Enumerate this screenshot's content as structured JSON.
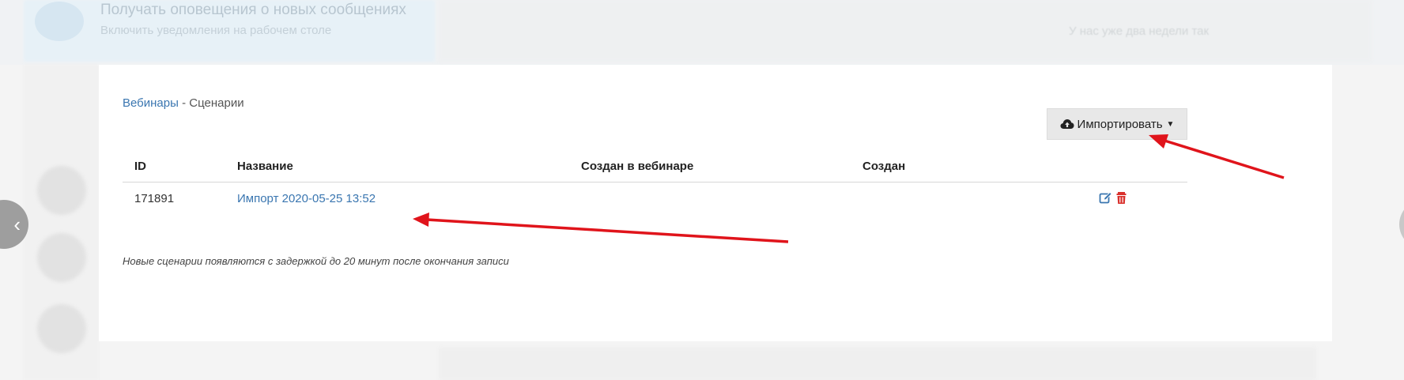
{
  "background": {
    "notification_title": "Получать оповещения о новых сообщениях",
    "notification_subtitle": "Включить уведомления на рабочем столе",
    "top_hint": "У нас уже два недели так"
  },
  "breadcrumb": {
    "parent": "Вебинары",
    "separator": "-",
    "current": "Сценарии"
  },
  "import_button": {
    "label": "Импортировать",
    "icon": "cloud-upload-icon"
  },
  "table": {
    "columns": [
      "ID",
      "Название",
      "Создан в вебинаре",
      "Создан"
    ],
    "rows": [
      {
        "id": "171891",
        "name": "Импорт 2020-05-25 13:52",
        "webinar": "",
        "created": ""
      }
    ]
  },
  "note": "Новые сценарии появляются с задержкой до 20 минут после окончания записи",
  "colors": {
    "link": "#3a76b0",
    "arrow": "#e0141b",
    "edit_icon": "#3a76b0",
    "delete_icon": "#d9302c"
  }
}
